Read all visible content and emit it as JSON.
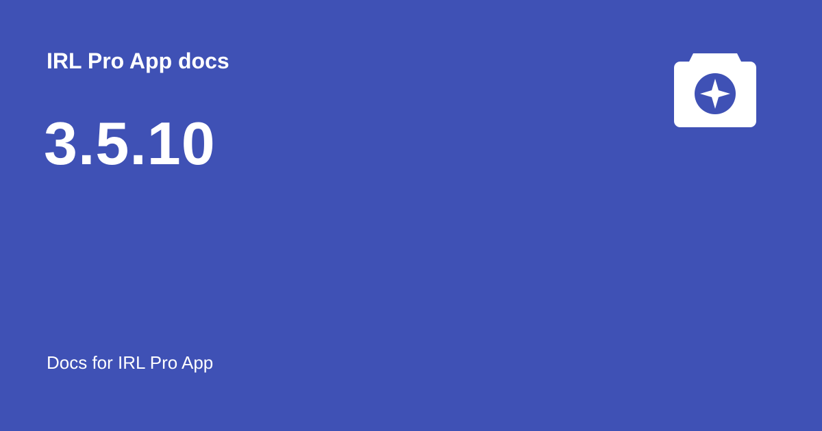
{
  "site": {
    "name": "IRL Pro App docs"
  },
  "page": {
    "title": "3.5.10",
    "description": "Docs for IRL Pro App"
  },
  "logo": {
    "icon": "camera-compass-icon",
    "color": "#ffffff"
  },
  "colors": {
    "background": "#3f51b5",
    "text": "#ffffff"
  }
}
